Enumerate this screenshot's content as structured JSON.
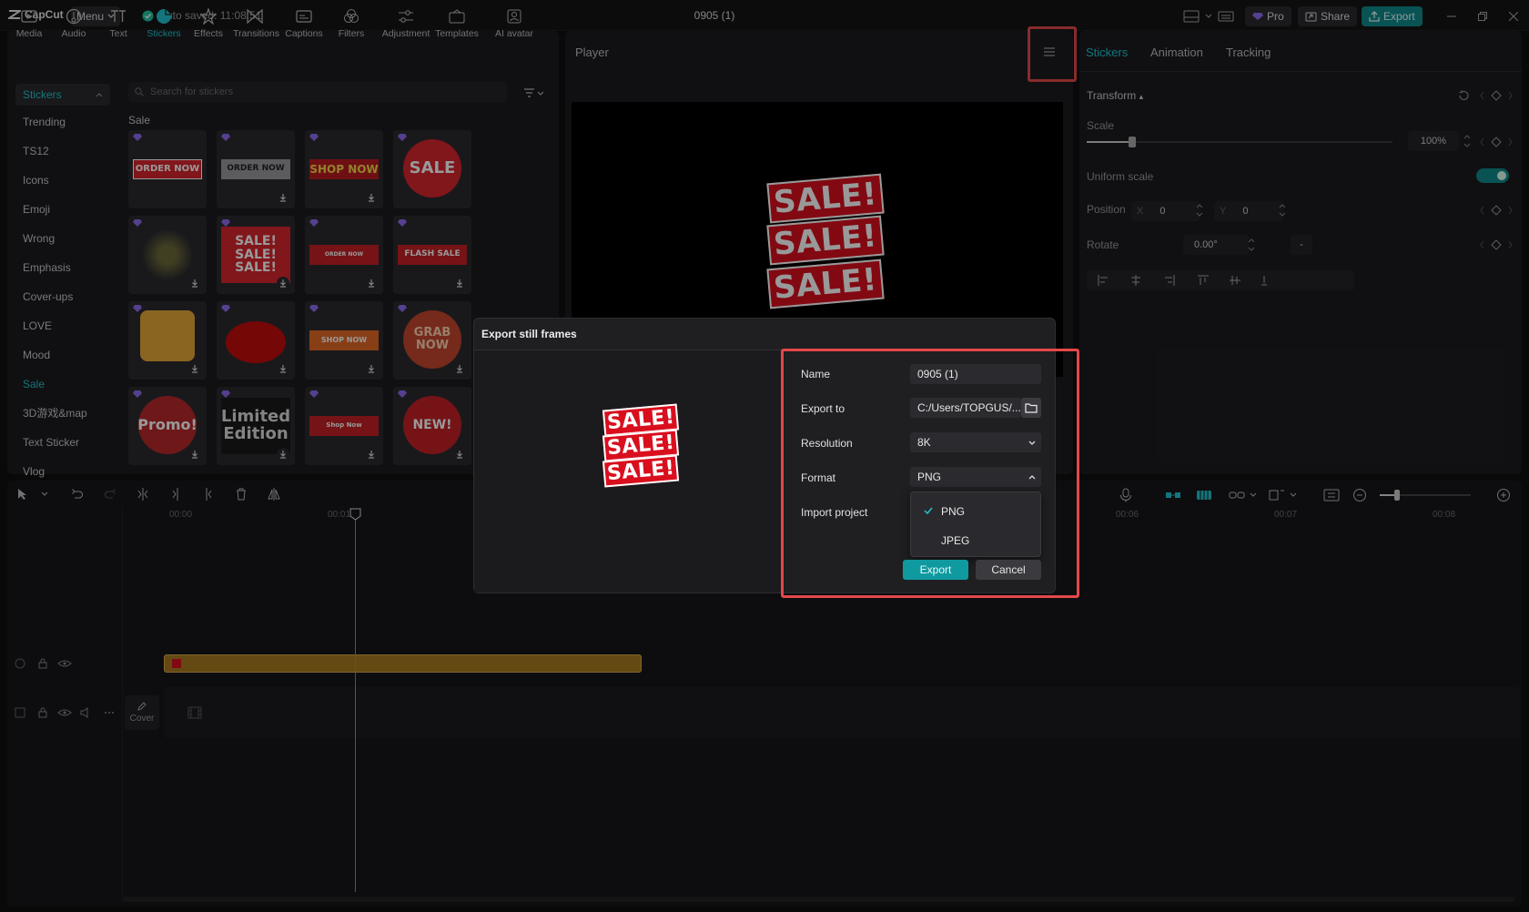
{
  "app": {
    "logo": "CapCut",
    "menu_label": "Menu",
    "autosave": "Auto saved: 11:08:51",
    "project_title": "0905 (1)",
    "pro_label": "Pro",
    "share_label": "Share",
    "export_label": "Export"
  },
  "toolbar": {
    "items": [
      {
        "label": "Media",
        "icon": "media-icon"
      },
      {
        "label": "Audio",
        "icon": "audio-icon"
      },
      {
        "label": "Text",
        "icon": "text-icon"
      },
      {
        "label": "Stickers",
        "icon": "stickers-icon"
      },
      {
        "label": "Effects",
        "icon": "effects-icon"
      },
      {
        "label": "Transitions",
        "icon": "transitions-icon"
      },
      {
        "label": "Captions",
        "icon": "captions-icon"
      },
      {
        "label": "Filters",
        "icon": "filters-icon"
      },
      {
        "label": "Adjustment",
        "icon": "adjustment-icon"
      },
      {
        "label": "Templates",
        "icon": "templates-icon"
      },
      {
        "label": "AI avatar",
        "icon": "ai-avatar-icon"
      }
    ]
  },
  "stickers": {
    "selected_category": "Stickers",
    "search_placeholder": "Search for stickers",
    "section_title": "Sale",
    "categories": [
      "Trending",
      "TS12",
      "Icons",
      "Emoji",
      "Wrong",
      "Emphasis",
      "Cover-ups",
      "LOVE",
      "Mood",
      "Sale",
      "3D游戏&map",
      "Text Sticker",
      "Vlog"
    ],
    "tiles": [
      {
        "text": "ORDER NOW"
      },
      {
        "text": "ORDER NOW"
      },
      {
        "text": "SHOP NOW"
      },
      {
        "text": "SALE"
      },
      {
        "text": ""
      },
      {
        "text": "SALE! SALE! SALE!"
      },
      {
        "text": "ORDER NOW"
      },
      {
        "text": "FLASH SALE"
      },
      {
        "text": ""
      },
      {
        "text": ""
      },
      {
        "text": "SHOP NOW"
      },
      {
        "text": "GRAB NOW"
      },
      {
        "text": "Promo!"
      },
      {
        "text": "Limited Edition"
      },
      {
        "text": "Shop Now"
      },
      {
        "text": "NEW!"
      }
    ]
  },
  "player": {
    "title": "Player",
    "sale_text": "SALE!"
  },
  "inspector": {
    "tabs": [
      "Stickers",
      "Animation",
      "Tracking"
    ],
    "transform_label": "Transform",
    "scale_label": "Scale",
    "scale_value": "100%",
    "scale_level": 0.15,
    "uniform_scale_label": "Uniform scale",
    "position_label": "Position",
    "pos_x_label": "X",
    "pos_x": "0",
    "pos_y_label": "Y",
    "pos_y": "0",
    "rotate_label": "Rotate",
    "rotate_value": "0.00°",
    "rotate_minus": "-"
  },
  "timeline": {
    "ruler": [
      "00:00",
      "00:01",
      "00:06",
      "00:07",
      "00:08"
    ],
    "cover_label": "Cover"
  },
  "dialog": {
    "title": "Export still frames",
    "name_label": "Name",
    "name_value": "0905 (1)",
    "export_to_label": "Export to",
    "export_to_value": "C:/Users/TOPGUS/...",
    "resolution_label": "Resolution",
    "resolution_value": "8K",
    "format_label": "Format",
    "format_value": "PNG",
    "import_label": "Import project",
    "format_options": [
      "PNG",
      "JPEG"
    ],
    "export_button": "Export",
    "cancel_button": "Cancel"
  },
  "colors": {
    "accent": "#22c3cf",
    "highlight": "#e4484a",
    "track": "#a87a1e"
  }
}
